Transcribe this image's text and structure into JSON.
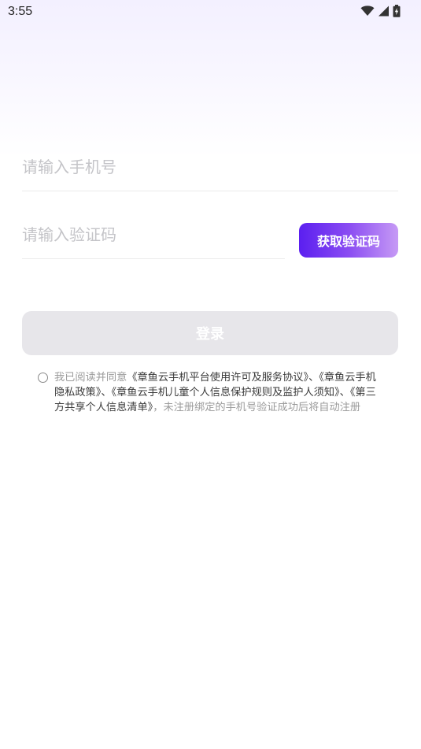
{
  "status_bar": {
    "time": "3:55",
    "icons": [
      "wifi-icon",
      "cellular-signal-icon",
      "battery-charging-icon"
    ]
  },
  "login_form": {
    "phone_placeholder": "请输入手机号",
    "phone_value": "",
    "code_placeholder": "请输入验证码",
    "code_value": "",
    "get_code_label": "获取验证码",
    "login_label": "登录"
  },
  "agreement": {
    "prefix": "我已阅读并同意",
    "links": [
      "《章鱼云手机平台使用许可及服务协议》",
      "《章鱼云手机隐私政策》",
      "《章鱼云手机儿童个人信息保护规则及监护人须知》",
      "《第三方共享个人信息清单》"
    ],
    "separators": [
      "、",
      "、",
      "、"
    ],
    "suffix": "，未注册绑定的手机号验证成功后将自动注册",
    "checked": false
  },
  "colors": {
    "accent_start": "#5b1ff0",
    "accent_end": "#c69af5",
    "login_disabled_bg": "#e7e6ea",
    "placeholder": "#c4c4c8",
    "link_text": "#3a3a3a",
    "secondary_text": "#9b9b9b"
  }
}
